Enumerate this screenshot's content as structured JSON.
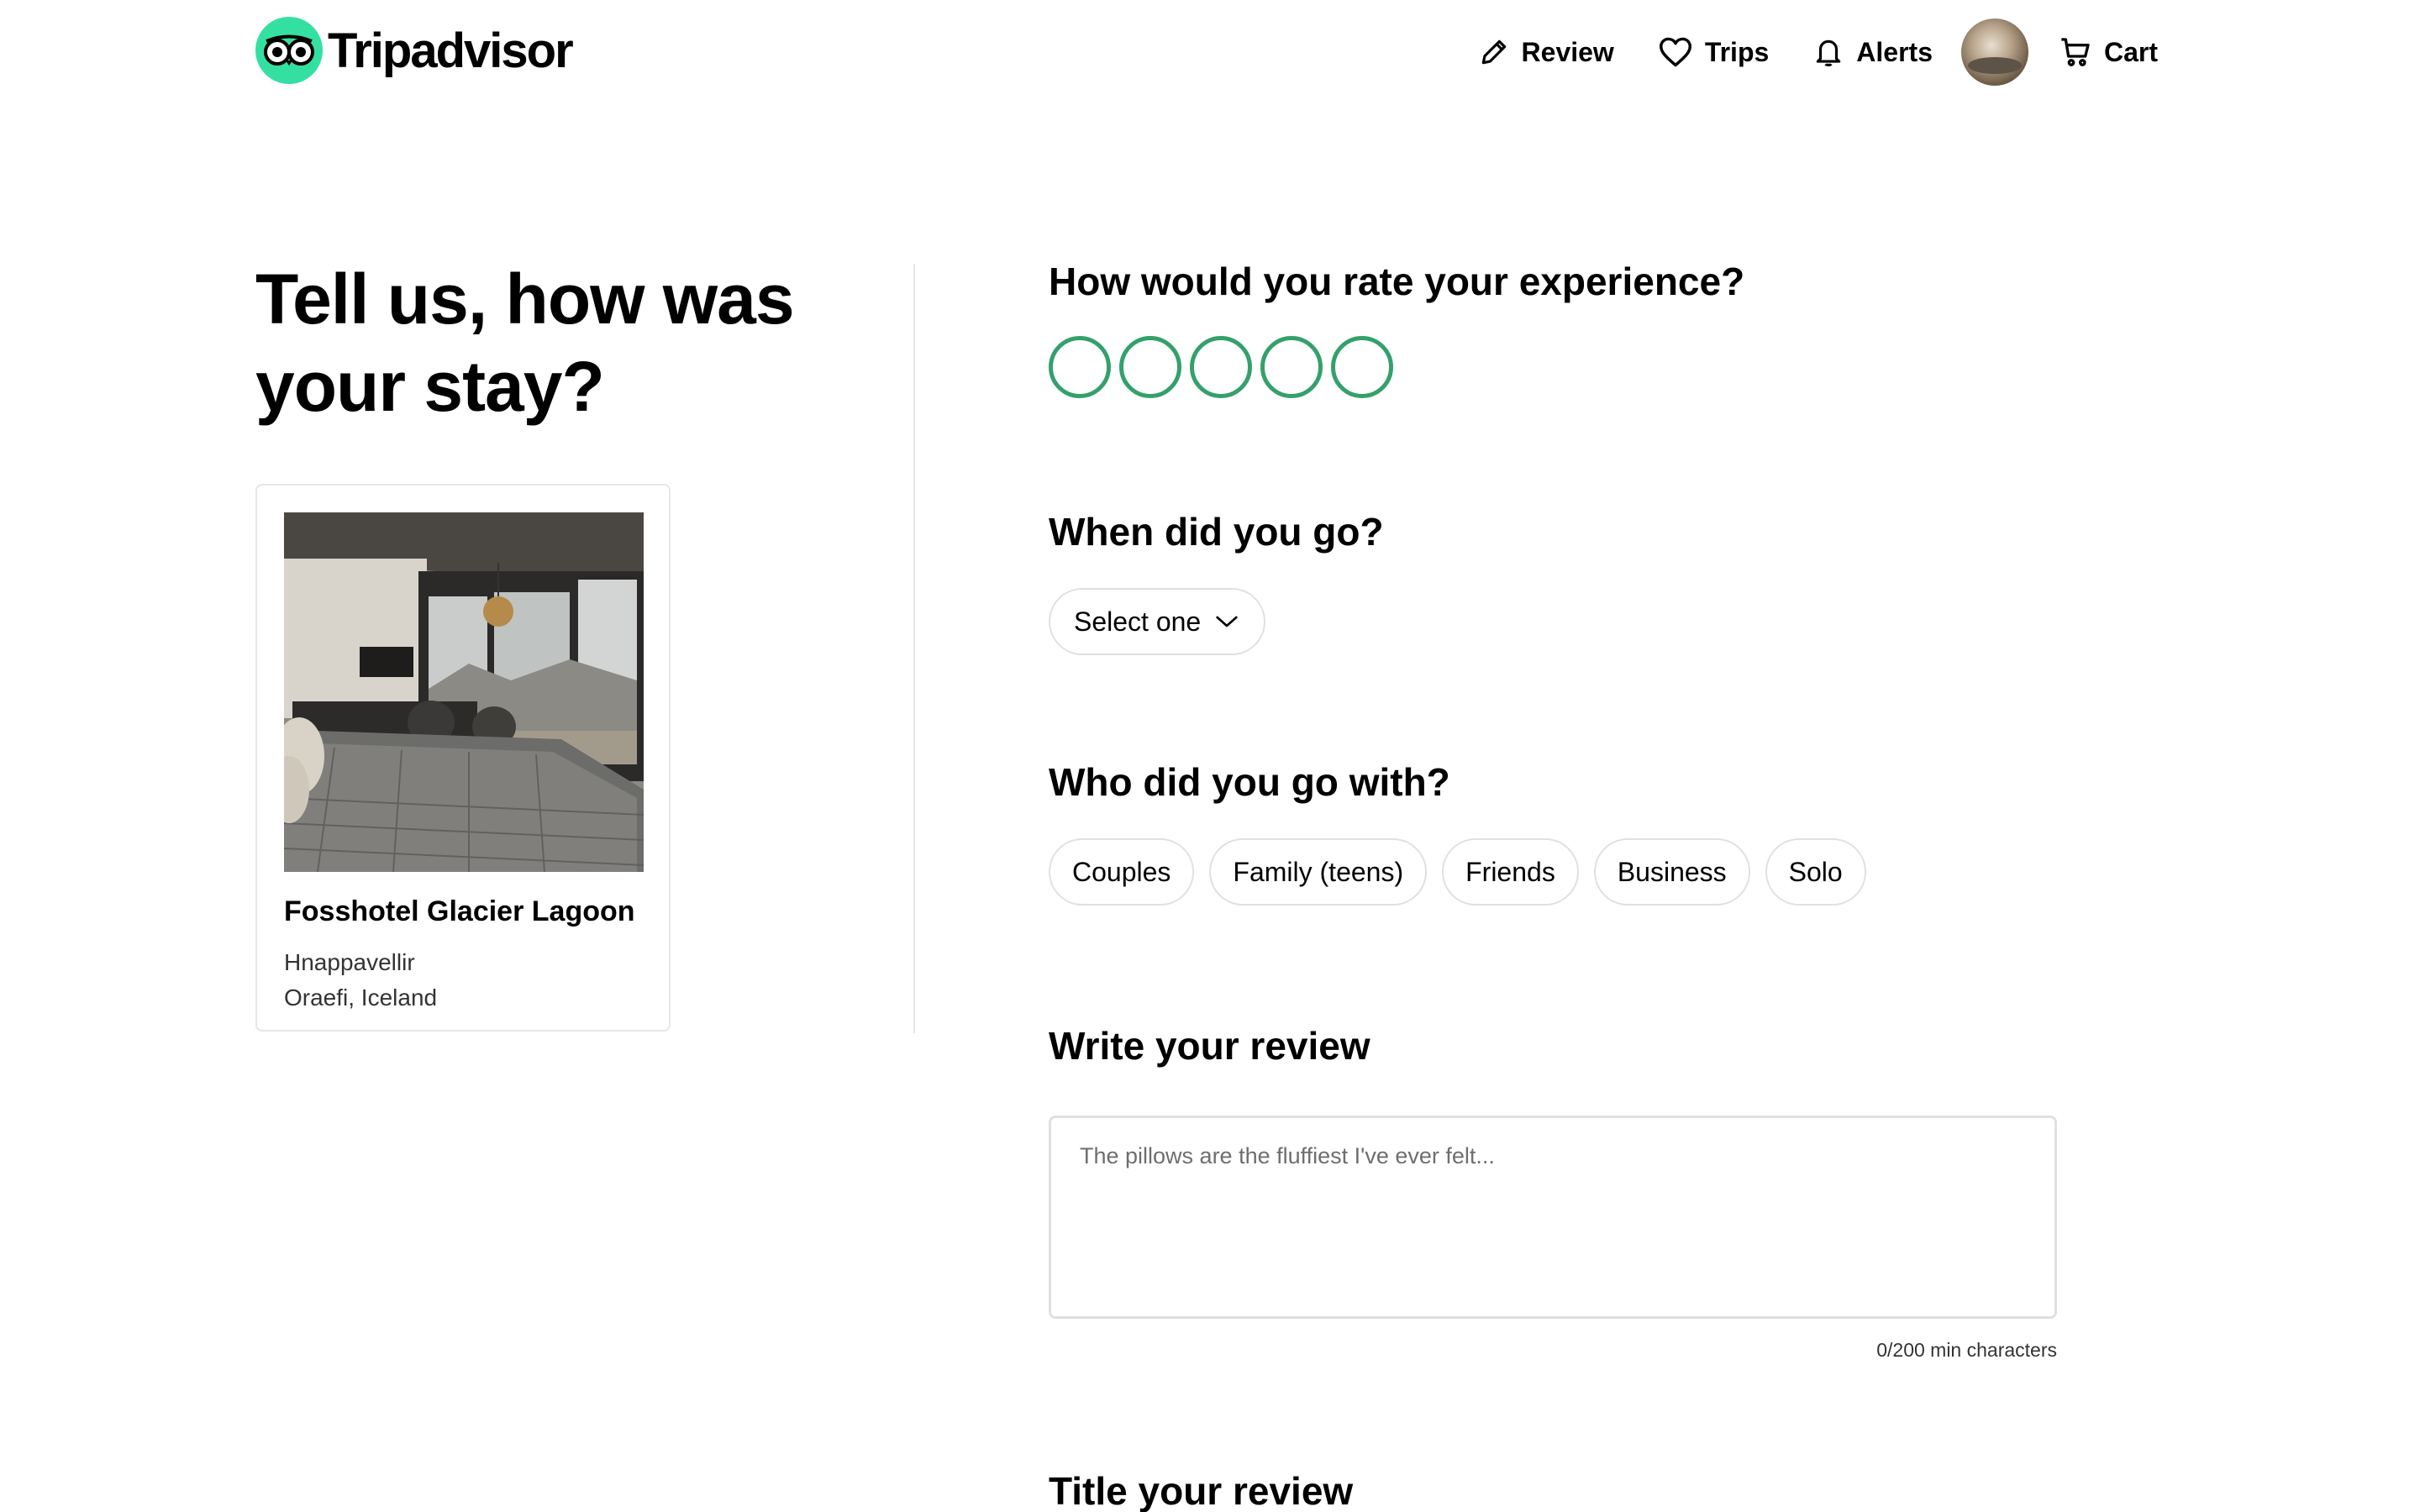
{
  "header": {
    "brand": "Tripadvisor",
    "nav": {
      "review": "Review",
      "trips": "Trips",
      "alerts": "Alerts",
      "cart": "Cart"
    },
    "brand_color": "#34e0a1"
  },
  "headline": {
    "line1": "Tell us, how was",
    "line2": "your stay?"
  },
  "hotel": {
    "name": "Fosshotel Glacier Lagoon",
    "area": "Hnappavellir",
    "location": "Oraefi, Iceland"
  },
  "rating": {
    "question": "How would you rate your experience?",
    "max": 5,
    "selected": 0,
    "color": "#34a06b"
  },
  "when": {
    "question": "When did you go?",
    "select_label": "Select one"
  },
  "who": {
    "question": "Who did you go with?",
    "options": [
      "Couples",
      "Family (teens)",
      "Friends",
      "Business",
      "Solo"
    ]
  },
  "review": {
    "heading": "Write your review",
    "placeholder": "The pillows are the fluffiest I've ever felt...",
    "counter": "0/200 min characters"
  },
  "title": {
    "heading": "Title your review"
  }
}
